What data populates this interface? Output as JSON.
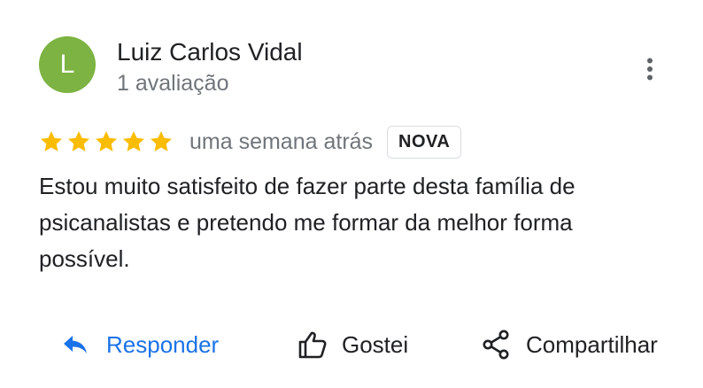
{
  "reviewer": {
    "initial": "L",
    "avatar_color": "#7cb342",
    "name": "Luiz Carlos Vidal",
    "meta": "1 avaliação"
  },
  "menu": {
    "icon": "more-vert-icon"
  },
  "review": {
    "rating": 5,
    "max_rating": 5,
    "star_color": "#fbbc04",
    "time": "uma semana atrás",
    "badge": "NOVA",
    "text": "Estou muito satisfeito de fazer parte desta família de psicanalistas e pretendo me formar da melhor forma possível."
  },
  "actions": {
    "reply": {
      "label": "Responder",
      "icon": "reply-icon",
      "color": "#1a73e8"
    },
    "like": {
      "label": "Gostei",
      "icon": "thumb-up-icon"
    },
    "share": {
      "label": "Compartilhar",
      "icon": "share-icon"
    }
  }
}
